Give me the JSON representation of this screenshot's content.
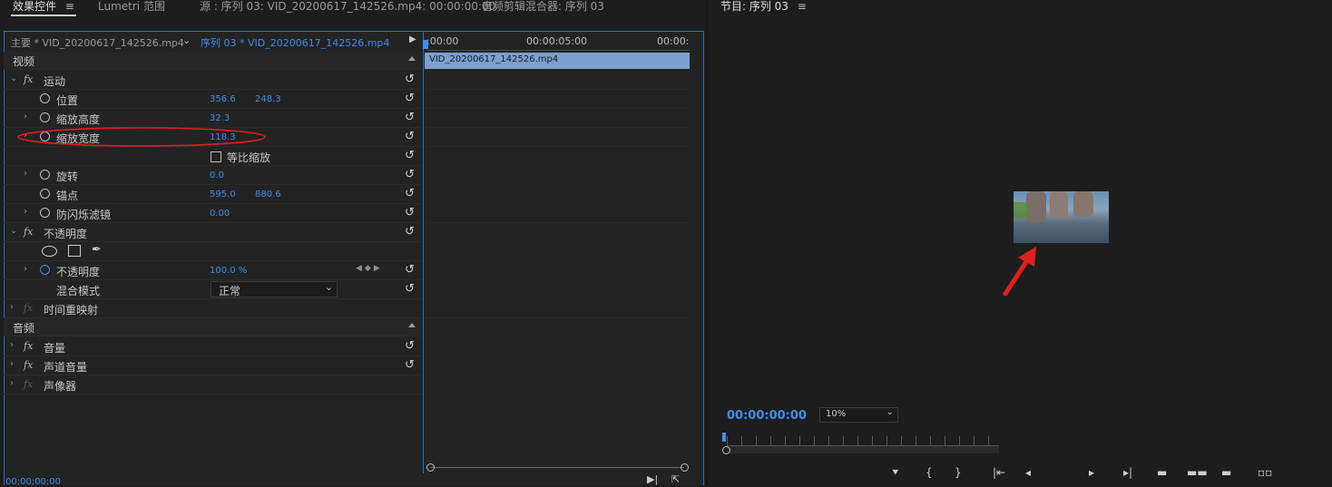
{
  "tabs": {
    "effect_controls": "效果控件",
    "menu_icon": "≡",
    "lumetri": "Lumetri 范围",
    "source": "源 : 序列 03: VID_20200617_142526.mp4: 00:00:00:00",
    "audio_mixer": "音频剪辑混合器: 序列 03",
    "program": "节目: 序列 03"
  },
  "clip_header": {
    "master": "主要 * VID_20200617_142526.mp4",
    "sequence": "序列 03 * VID_20200617_142526.mp4",
    "time_start": ":00:00",
    "time_mid": "00:00:05:00",
    "time_end": "00:00:",
    "clip_name": "VID_20200617_142526.mp4"
  },
  "sections": {
    "video": "视频",
    "audio": "音频"
  },
  "motion": {
    "title": "运动",
    "position_label": "位置",
    "position_x": "356.6",
    "position_y": "248.3",
    "scale_h_label": "缩放高度",
    "scale_h": "32.3",
    "scale_w_label": "缩放宽度",
    "scale_w": "118.3",
    "uniform_label": "等比缩放",
    "rotation_label": "旋转",
    "rotation": "0.0",
    "anchor_label": "锚点",
    "anchor_x": "595.0",
    "anchor_y": "880.6",
    "antiflicker_label": "防闪烁滤镜",
    "antiflicker": "0.00"
  },
  "opacity": {
    "title": "不透明度",
    "opacity_label": "不透明度",
    "opacity": "100.0 %",
    "blend_label": "混合模式",
    "blend": "正常"
  },
  "time_remap": "时间重映射",
  "audio_fx": {
    "volume": "音量",
    "channel_volume": "声道音量",
    "panner": "声像器"
  },
  "bottom_timecode": "00;00;00;00",
  "program": {
    "timecode": "00:00:00:00",
    "zoom": "10%"
  },
  "colors": {
    "accent": "#3e8ef0",
    "clip_bar": "#7aa0cf",
    "annotation": "#e02020"
  }
}
